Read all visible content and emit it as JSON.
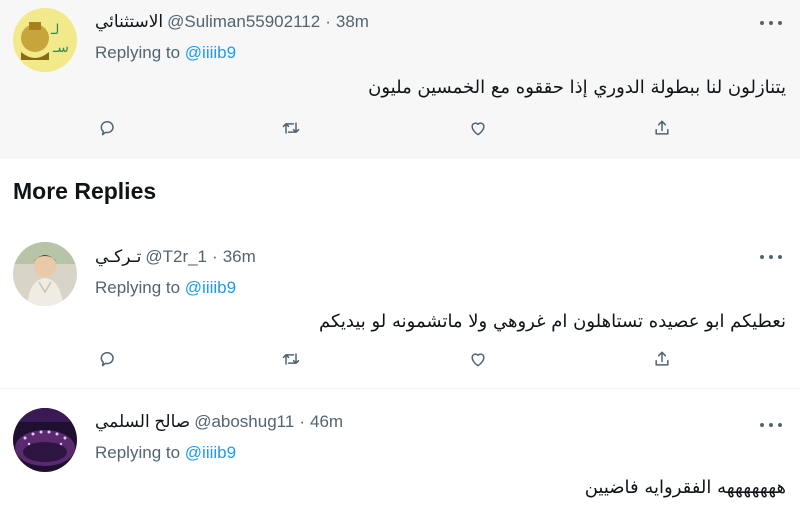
{
  "tweets": [
    {
      "display_name": "الاستثنائي",
      "handle": "@Suliman55902112",
      "dot": "·",
      "time": "38m",
      "replying_label": "Replying to",
      "replying_to": "@iiiib9",
      "text": "يتنازلون لنا ببطولة الدوري إذا حققوه مع الخمسين مليون"
    },
    {
      "display_name": "تـركـي",
      "handle": "@T2r_1",
      "dot": "·",
      "time": "36m",
      "replying_label": "Replying to",
      "replying_to": "@iiiib9",
      "text": "نعطيكم ابو عصيده تستاهلون ام غروهي ولا ماتشمونه لو بيديكم"
    },
    {
      "display_name": "صالح السلمي",
      "handle": "@aboshug11",
      "dot": "·",
      "time": "46m",
      "replying_label": "Replying to",
      "replying_to": "@iiiib9",
      "text": "هههههههه الفقروايه فاضيين"
    }
  ],
  "section": {
    "title": "More Replies"
  },
  "colors": {
    "accent": "#1d9bf0",
    "muted": "#536471",
    "text": "#0f1419",
    "highlight_bg": "#f7f7f7"
  },
  "icons": {
    "reply": "reply-icon",
    "retweet": "retweet-icon",
    "like": "like-icon",
    "share": "share-icon",
    "more": "more-icon"
  }
}
